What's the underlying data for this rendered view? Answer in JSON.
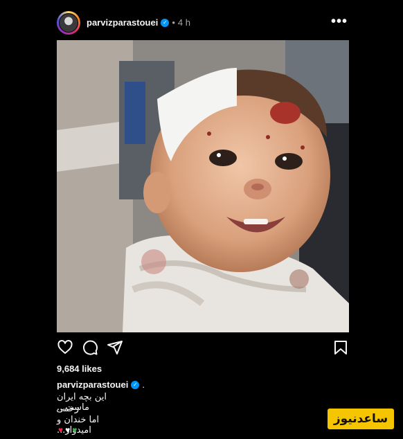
{
  "post": {
    "username": "parvizparastouei",
    "separator": "•",
    "time": "4 h",
    "more_label": "•••"
  },
  "photo": {
    "description_icon": "photo-image"
  },
  "actions": {
    "like_icon": "heart-icon",
    "comment_icon": "comment-icon",
    "share_icon": "send-icon",
    "save_icon": "bookmark-icon"
  },
  "likes": "9,684 likes",
  "caption": {
    "username": "parvizparastouei",
    "suffix": ".",
    "lines": [
      "این بچه ایران ماست...",
      "زخمی",
      "اما خندان و امیدوار..."
    ],
    "hearts": [
      {
        "glyph": "♥",
        "color": "#f02849"
      },
      {
        "glyph": "♥",
        "color": "#ffffff"
      },
      {
        "glyph": "♥",
        "color": "#39b54a"
      }
    ]
  },
  "watermark": "ساعدنیوز",
  "colors": {
    "background": "#000000",
    "verified": "#0095f6",
    "watermark_bg": "#f5c500"
  }
}
